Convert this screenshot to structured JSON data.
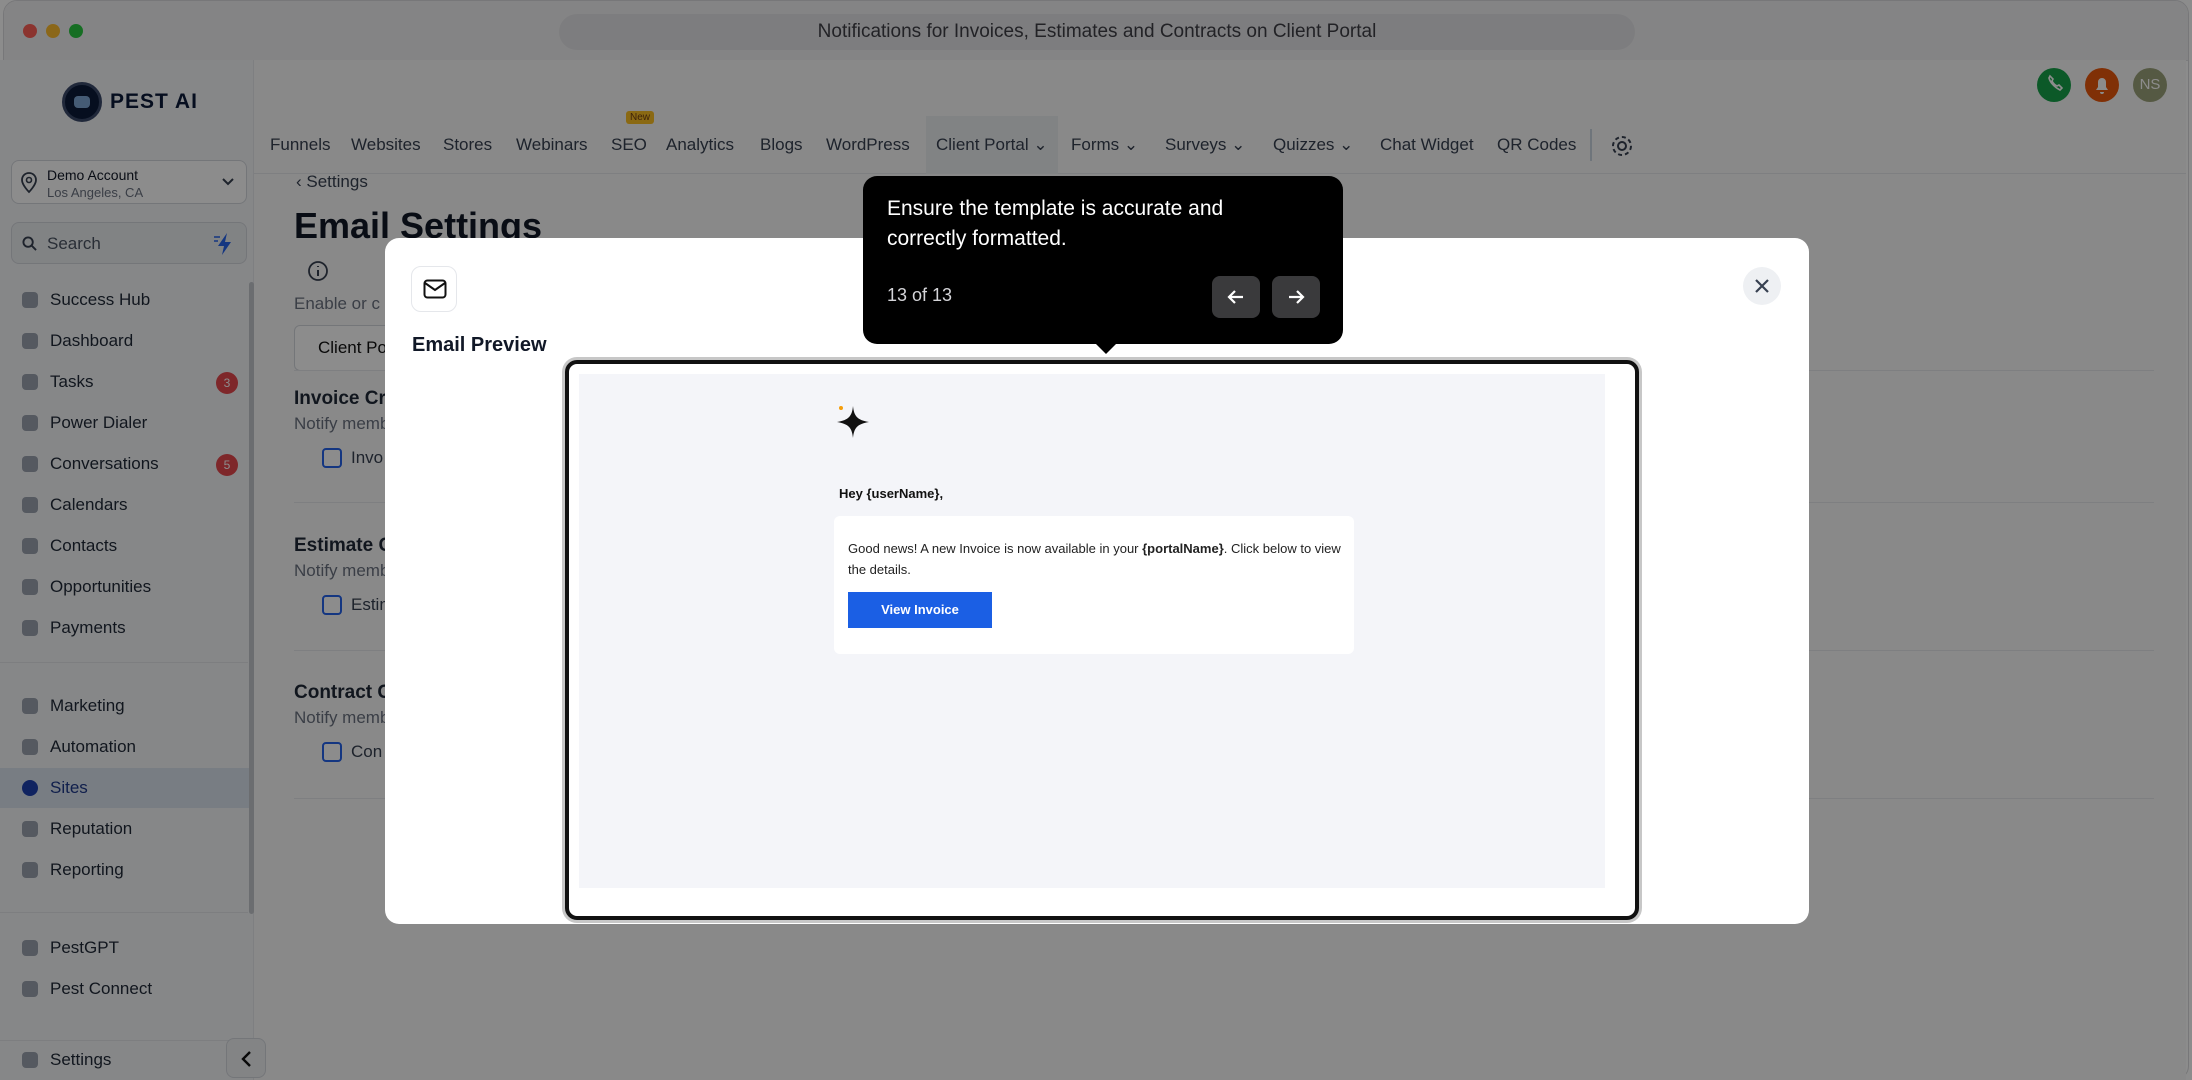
{
  "window": {
    "title": "Notifications for Invoices, Estimates and Contracts on Client Portal"
  },
  "brand": {
    "name": "PEST AI"
  },
  "account": {
    "name": "Demo Account",
    "location": "Los Angeles, CA"
  },
  "search": {
    "placeholder": "Search"
  },
  "sidebar": {
    "items": [
      {
        "label": "Success Hub",
        "icon": "trophy-icon"
      },
      {
        "label": "Dashboard",
        "icon": "dashboard-icon"
      },
      {
        "label": "Tasks",
        "icon": "task-icon",
        "badge": "3"
      },
      {
        "label": "Power Dialer",
        "icon": "dialer-icon"
      },
      {
        "label": "Conversations",
        "icon": "chat-icon",
        "badge": "5"
      },
      {
        "label": "Calendars",
        "icon": "calendar-icon"
      },
      {
        "label": "Contacts",
        "icon": "person-icon"
      },
      {
        "label": "Opportunities",
        "icon": "filter-icon"
      },
      {
        "label": "Payments",
        "icon": "card-icon"
      },
      {
        "label": "Marketing",
        "icon": "megaphone-icon"
      },
      {
        "label": "Automation",
        "icon": "automation-icon"
      },
      {
        "label": "Sites",
        "icon": "globe-icon",
        "active": true
      },
      {
        "label": "Reputation",
        "icon": "star-icon"
      },
      {
        "label": "Reporting",
        "icon": "chart-icon"
      },
      {
        "label": "PestGPT",
        "icon": "robot-icon"
      },
      {
        "label": "Pest Connect",
        "icon": "connect-icon"
      },
      {
        "label": "Settings",
        "icon": "gear-icon"
      }
    ]
  },
  "topbar": {
    "tabs": [
      "Funnels",
      "Websites",
      "Stores",
      "Webinars",
      "SEO",
      "Analytics",
      "Blogs",
      "WordPress",
      "Client Portal",
      "Forms",
      "Surveys",
      "Quizzes",
      "Chat Widget",
      "QR Codes"
    ],
    "new_badge": "New",
    "avatar_initials": "NS"
  },
  "page": {
    "back_label": "Settings",
    "title": "Email Settings",
    "description_partial": "Enable or c",
    "subtab_partial": "Client Po",
    "sections": [
      {
        "heading": "Invoice Cr",
        "desc": "Notify memb",
        "checkbox_label": "Invo"
      },
      {
        "heading": "Estimate C",
        "desc": "Notify memb",
        "checkbox_label": "Estin"
      },
      {
        "heading": "Contract C",
        "desc": "Notify memb",
        "checkbox_label": "Con"
      }
    ]
  },
  "modal": {
    "title": "Email Preview",
    "email": {
      "greeting": "Hey {userName},",
      "body_before": "Good news! A new Invoice is now available in your ",
      "body_bold": "{portalName}",
      "body_after": ". Click below to view the details.",
      "button_label": "View Invoice",
      "button_color": "#1b5fe4"
    }
  },
  "tour": {
    "message": "Ensure the template is accurate and correctly formatted.",
    "progress": "13 of 13"
  },
  "colors": {
    "accent": "#1e40af",
    "call_button": "#16a34a",
    "bell_button": "#ea580c",
    "avatar": "#9ca37a",
    "badge": "#e5484d"
  }
}
